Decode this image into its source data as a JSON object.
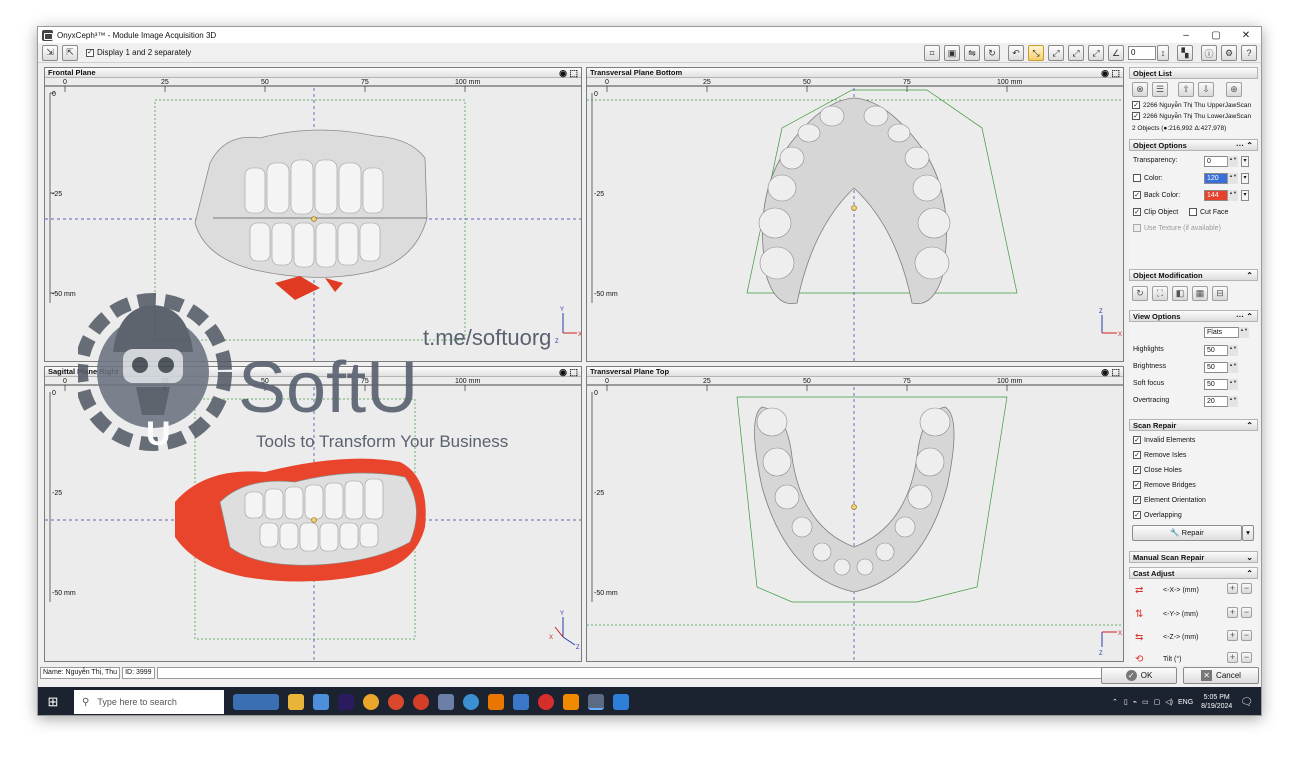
{
  "window": {
    "title": "OnyxCeph³™ - Module Image Acquisition 3D",
    "controls": [
      "–",
      "▢",
      "✕"
    ]
  },
  "toolbar": {
    "display_separately_label": "Display 1 and 2 separately",
    "display_separately_checked": true,
    "rotation_value": "0"
  },
  "viewports": {
    "frontal": {
      "title": "Frontal Plane",
      "axis_v": "Y",
      "axis_h": "X",
      "axis_z": "Z"
    },
    "transversal_bottom": {
      "title": "Transversal Plane Bottom",
      "axis_v": "Z",
      "axis_h": "X",
      "axis_z": ""
    },
    "sagittal": {
      "title": "Sagittal Plane Right",
      "axis_v": "Y",
      "axis_h": "Z",
      "axis_z": "X"
    },
    "transversal_top": {
      "title": "Transversal Plane Top",
      "axis_v": "",
      "axis_h": "X",
      "axis_z": "Z"
    }
  },
  "ruler": {
    "ticks": [
      "0",
      "25",
      "50",
      "75",
      "100 mm"
    ],
    "vticks": [
      "0",
      "-25",
      "-50 mm"
    ]
  },
  "watermark": {
    "brand": "SoftU",
    "handle": "t.me/softuorg",
    "tagline": "Tools to Transform Your Business"
  },
  "object_list": {
    "title": "Object List",
    "items": [
      {
        "label": "2266 Nguyễn Thị Thu UpperJawScan",
        "checked": true
      },
      {
        "label": "2266 Nguyễn Thị Thu LowerJawScan",
        "checked": true
      }
    ],
    "summary": "2 Objects (●:216,992 Δ:427,978)"
  },
  "object_options": {
    "title": "Object Options",
    "transparency_label": "Transparency:",
    "transparency_value": "0",
    "color_label": "Color:",
    "color_value": "120",
    "color_checked": false,
    "back_color_label": "Back Color:",
    "back_color_value": "144",
    "back_color_checked": true,
    "clip_object_label": "Clip Object",
    "clip_object_checked": true,
    "cut_face_label": "Cut Face",
    "cut_face_checked": false,
    "use_texture_label": "Use Texture (if available)",
    "color_swatch": "#3a6fd8",
    "back_swatch": "#e8412b"
  },
  "object_modification": {
    "title": "Object Modification"
  },
  "view_options": {
    "title": "View Options",
    "shading": "Flats",
    "highlights_label": "Highlights",
    "highlights_value": "50",
    "brightness_label": "Brightness",
    "brightness_value": "50",
    "soft_focus_label": "Soft focus",
    "soft_focus_value": "50",
    "overtracing_label": "Overtracing",
    "overtracing_value": "20"
  },
  "scan_repair": {
    "title": "Scan Repair",
    "options": [
      {
        "label": "Invalid Elements",
        "checked": true
      },
      {
        "label": "Remove Isles",
        "checked": true
      },
      {
        "label": "Close Holes",
        "checked": true
      },
      {
        "label": "Remove Bridges",
        "checked": true
      },
      {
        "label": "Element Orientation",
        "checked": true
      },
      {
        "label": "Overlapping",
        "checked": true
      }
    ],
    "repair_label": "Repair"
  },
  "manual_scan_repair": {
    "title": "Manual Scan Repair"
  },
  "cast_adjust": {
    "title": "Cast Adjust",
    "rows": [
      {
        "label": "<-X-> (mm)"
      },
      {
        "label": "<-Y-> (mm)"
      },
      {
        "label": "<-Z-> (mm)"
      },
      {
        "label": "Tilt (°)"
      }
    ]
  },
  "status": {
    "name": "Name: Nguyễn Thị, Thu",
    "id": "ID: 3999",
    "ok_label": "OK",
    "cancel_label": "Cancel"
  },
  "taskbar": {
    "search_placeholder": "Type here to search",
    "lang": "ENG",
    "time": "5:05 PM",
    "date": "8/19/2024"
  }
}
